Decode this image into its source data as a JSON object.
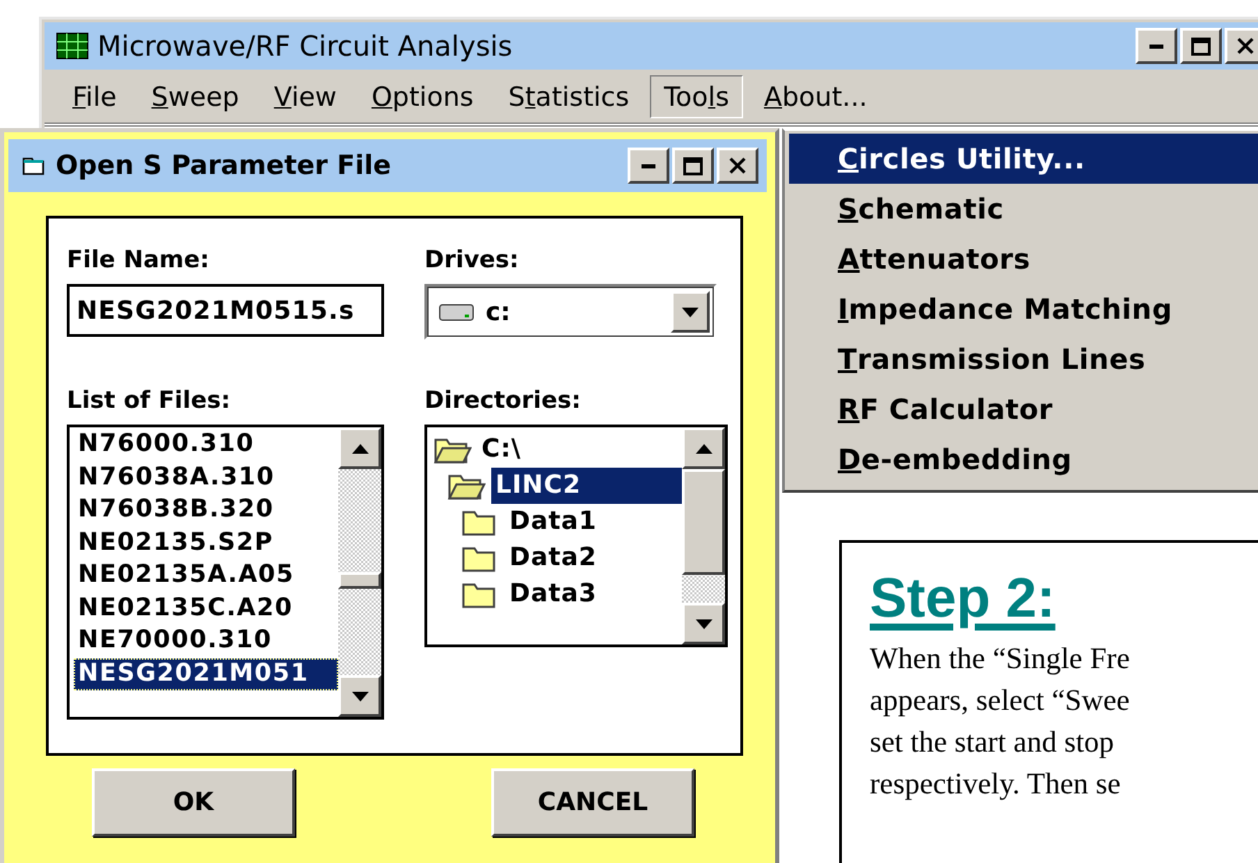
{
  "main_window": {
    "title": "Microwave/RF Circuit Analysis",
    "menu": [
      {
        "label": [
          {
            "text": "F",
            "underlined": true
          },
          {
            "text": "ile",
            "underlined": false
          }
        ],
        "selected": false
      },
      {
        "label": [
          {
            "text": "S",
            "underlined": true
          },
          {
            "text": "weep",
            "underlined": false
          }
        ],
        "selected": false
      },
      {
        "label": [
          {
            "text": "V",
            "underlined": true
          },
          {
            "text": "iew",
            "underlined": false
          }
        ],
        "selected": false
      },
      {
        "label": [
          {
            "text": "O",
            "underlined": true
          },
          {
            "text": "ptions",
            "underlined": false
          }
        ],
        "selected": false
      },
      {
        "label": [
          {
            "text": "S",
            "underlined": false
          },
          {
            "text": "t",
            "underlined": true
          },
          {
            "text": "atistics",
            "underlined": false
          }
        ],
        "selected": false
      },
      {
        "label": [
          {
            "text": "Too",
            "underlined": false
          },
          {
            "text": "l",
            "underlined": true
          },
          {
            "text": "s",
            "underlined": false
          }
        ],
        "selected": true
      },
      {
        "label": [
          {
            "text": "A",
            "underlined": true
          },
          {
            "text": "bout...",
            "underlined": false
          }
        ],
        "selected": false
      }
    ]
  },
  "tools_menu": {
    "items": [
      {
        "label": [
          {
            "text": "C",
            "underlined": true
          },
          {
            "text": "ircles Utility...",
            "underlined": false
          }
        ],
        "selected": true
      },
      {
        "label": [
          {
            "text": "S",
            "underlined": true
          },
          {
            "text": "chematic",
            "underlined": false
          }
        ],
        "selected": false
      },
      {
        "label": [
          {
            "text": "A",
            "underlined": true
          },
          {
            "text": "ttenuators",
            "underlined": false
          }
        ],
        "selected": false
      },
      {
        "label": [
          {
            "text": "I",
            "underlined": true
          },
          {
            "text": "mpedance Matching",
            "underlined": false
          }
        ],
        "selected": false
      },
      {
        "label": [
          {
            "text": "T",
            "underlined": true
          },
          {
            "text": "ransmission Lines",
            "underlined": false
          }
        ],
        "selected": false
      },
      {
        "label": [
          {
            "text": "R",
            "underlined": true
          },
          {
            "text": "F Calculator",
            "underlined": false
          }
        ],
        "selected": false
      },
      {
        "label": [
          {
            "text": "D",
            "underlined": true
          },
          {
            "text": "e-embedding",
            "underlined": false
          }
        ],
        "selected": false
      }
    ]
  },
  "dialog": {
    "title": "Open S Parameter File",
    "file_name_label": "File Name:",
    "file_name_value": "NESG2021M0515.s",
    "drives_label": "Drives:",
    "drive_value": "c:",
    "files_label": "List of Files:",
    "files": [
      {
        "name": "N76000.310",
        "selected": false
      },
      {
        "name": "N76038A.310",
        "selected": false
      },
      {
        "name": "N76038B.320",
        "selected": false
      },
      {
        "name": "NE02135.S2P",
        "selected": false
      },
      {
        "name": "NE02135A.A05",
        "selected": false
      },
      {
        "name": "NE02135C.A20",
        "selected": false
      },
      {
        "name": "NE70000.310",
        "selected": false
      },
      {
        "name": "NESG2021M051",
        "selected": true
      }
    ],
    "directories_label": "Directories:",
    "directories": [
      {
        "name": "C:\\",
        "kind": "open",
        "selected": false,
        "children": [
          {
            "name": "LINC2",
            "kind": "open",
            "selected": true,
            "children": [
              {
                "name": "Data1",
                "kind": "closed",
                "selected": false
              },
              {
                "name": "Data2",
                "kind": "closed",
                "selected": false
              },
              {
                "name": "Data3",
                "kind": "closed",
                "selected": false
              }
            ]
          }
        ]
      }
    ],
    "buttons": [
      {
        "label": "OK"
      },
      {
        "label": "CANCEL"
      }
    ]
  },
  "note": {
    "title": "Step 2:",
    "lines": [
      "When the “Single Fre",
      "appears, select “Swee",
      "set the start and stop",
      "respectively.  Then se"
    ]
  }
}
